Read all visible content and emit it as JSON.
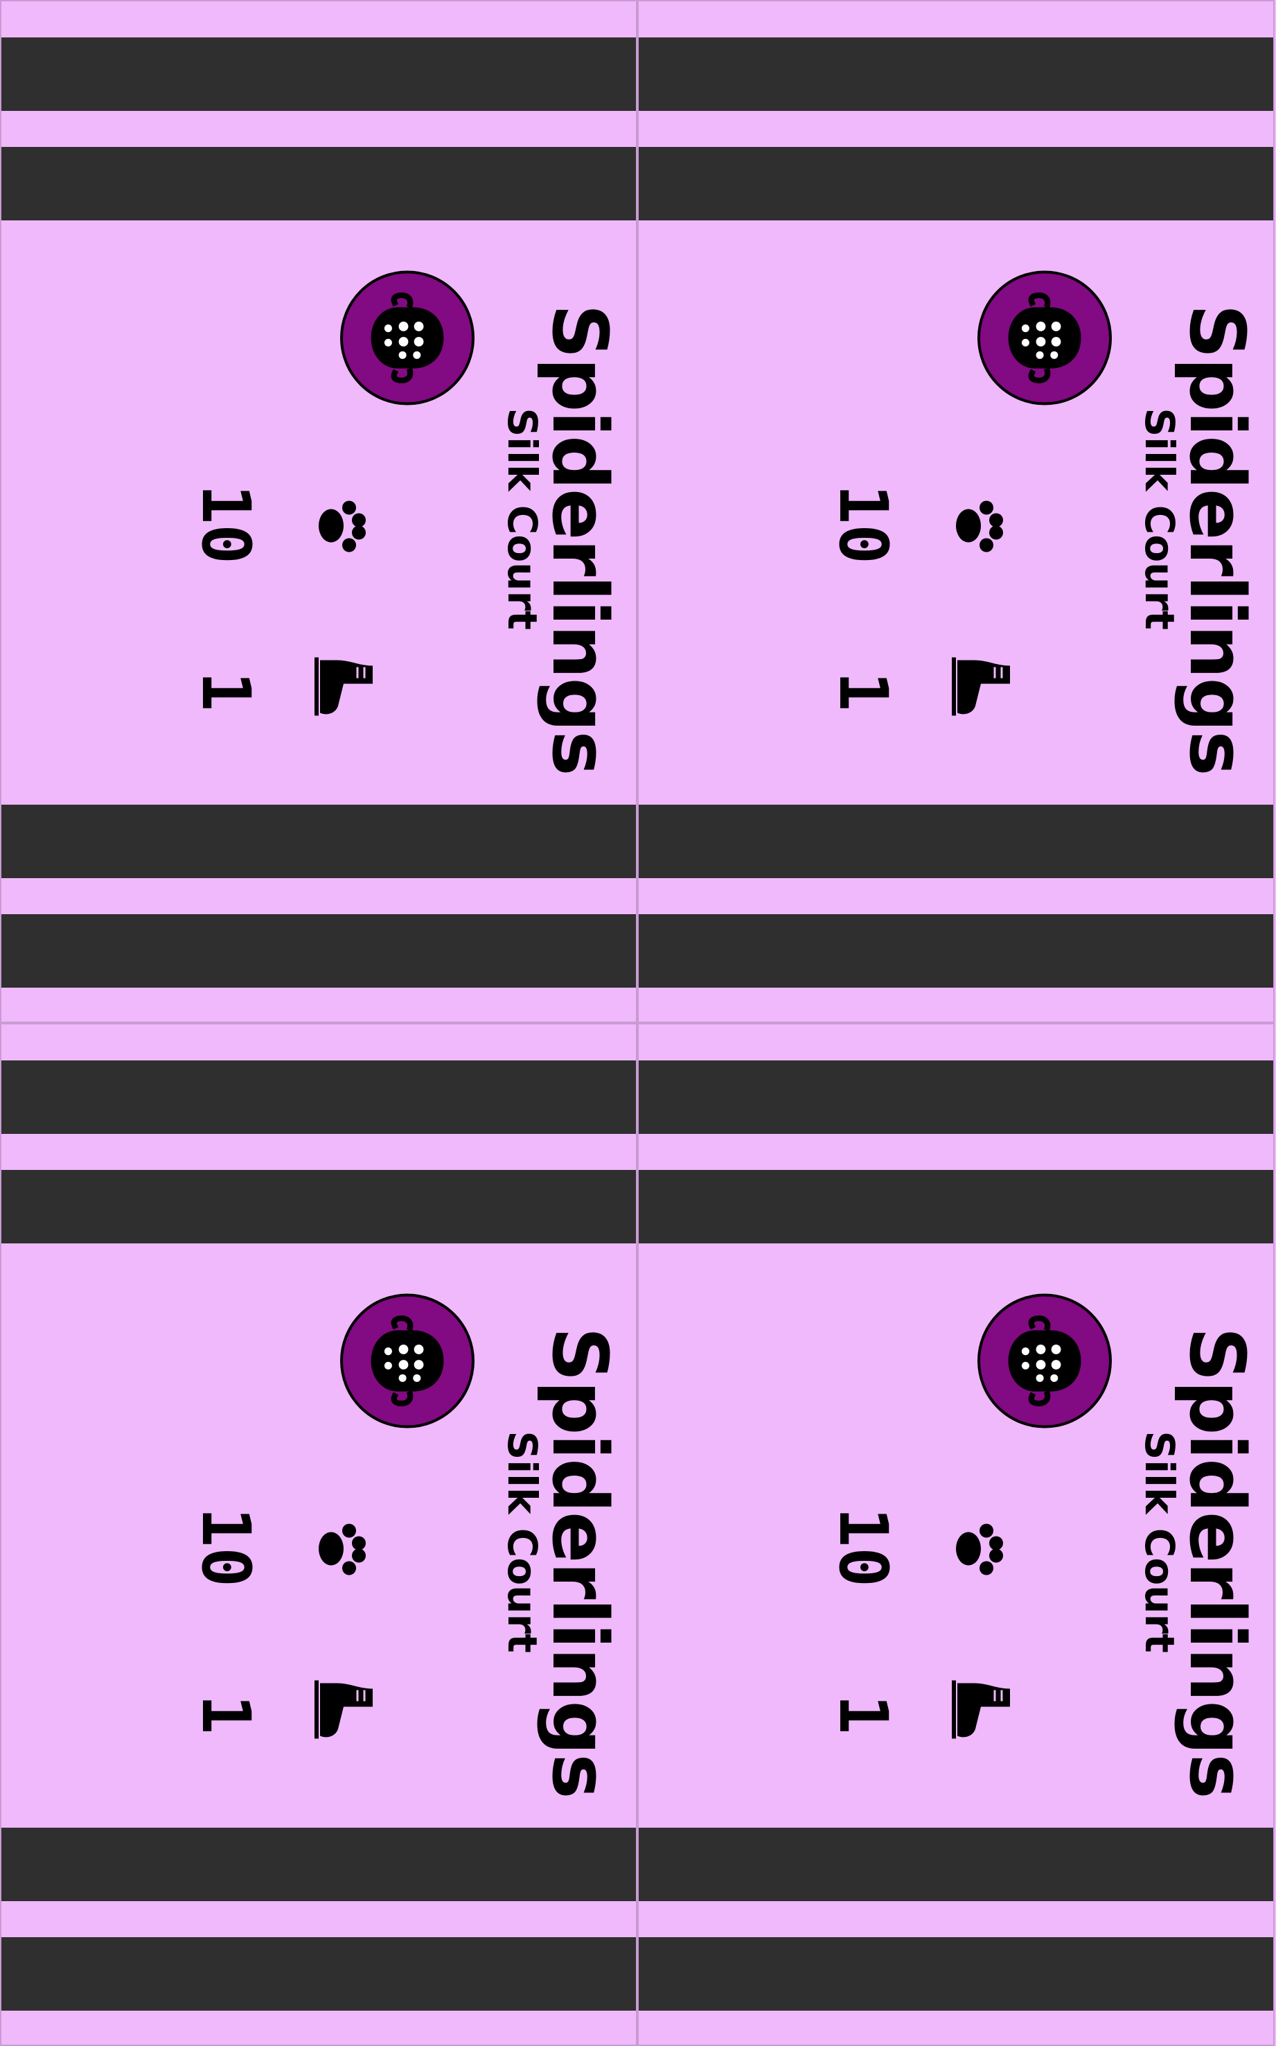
{
  "card": {
    "faction": "Silk Court",
    "name": "Spiderlings",
    "icons": {
      "badge": "spider-head-icon",
      "count": "paw-print-icon",
      "movement": "boot-icon"
    },
    "stats": {
      "count": "10",
      "movement": "1"
    }
  },
  "colors": {
    "card_background": "#f0b9fb",
    "band": "#2f2f2f",
    "badge_fill": "#820a82",
    "text": "#000000"
  }
}
